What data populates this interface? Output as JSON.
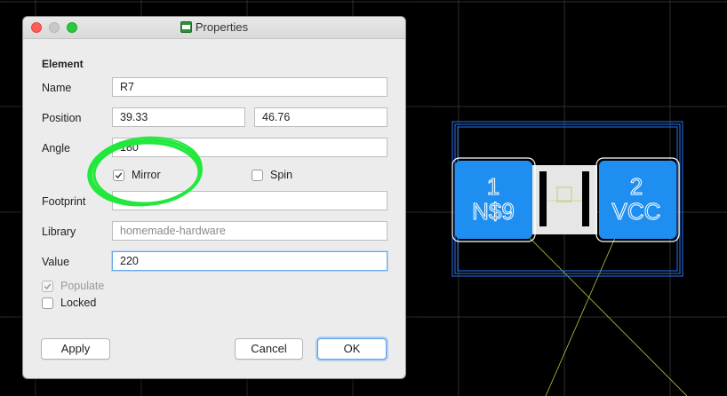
{
  "dialog": {
    "title": "Properties",
    "app_icon_text": "BRD",
    "section_title": "Element",
    "fields": {
      "name": {
        "label": "Name",
        "value": "R7"
      },
      "position": {
        "label": "Position",
        "x": "39.33",
        "y": "46.76"
      },
      "angle": {
        "label": "Angle",
        "value": "180"
      },
      "footprint": {
        "label": "Footprint",
        "value": ""
      },
      "library": {
        "label": "Library",
        "value": "homemade-hardware"
      },
      "value": {
        "label": "Value",
        "value": "220"
      }
    },
    "checkboxes": {
      "mirror": {
        "label": "Mirror",
        "checked": true
      },
      "spin": {
        "label": "Spin",
        "checked": false
      },
      "populate": {
        "label": "Populate",
        "checked": true,
        "disabled": true
      },
      "locked": {
        "label": "Locked",
        "checked": false
      }
    },
    "buttons": {
      "apply": "Apply",
      "cancel": "Cancel",
      "ok": "OK"
    }
  },
  "board": {
    "pad1": {
      "number": "1",
      "net": "N$9"
    },
    "pad2": {
      "number": "2",
      "net": "VCC"
    }
  },
  "colors": {
    "pad": "#1e8ff0",
    "outline": "#2a74f0",
    "grid": "#2e2e2e",
    "airwire": "#b9c94a",
    "annotation": "#22e83c"
  }
}
